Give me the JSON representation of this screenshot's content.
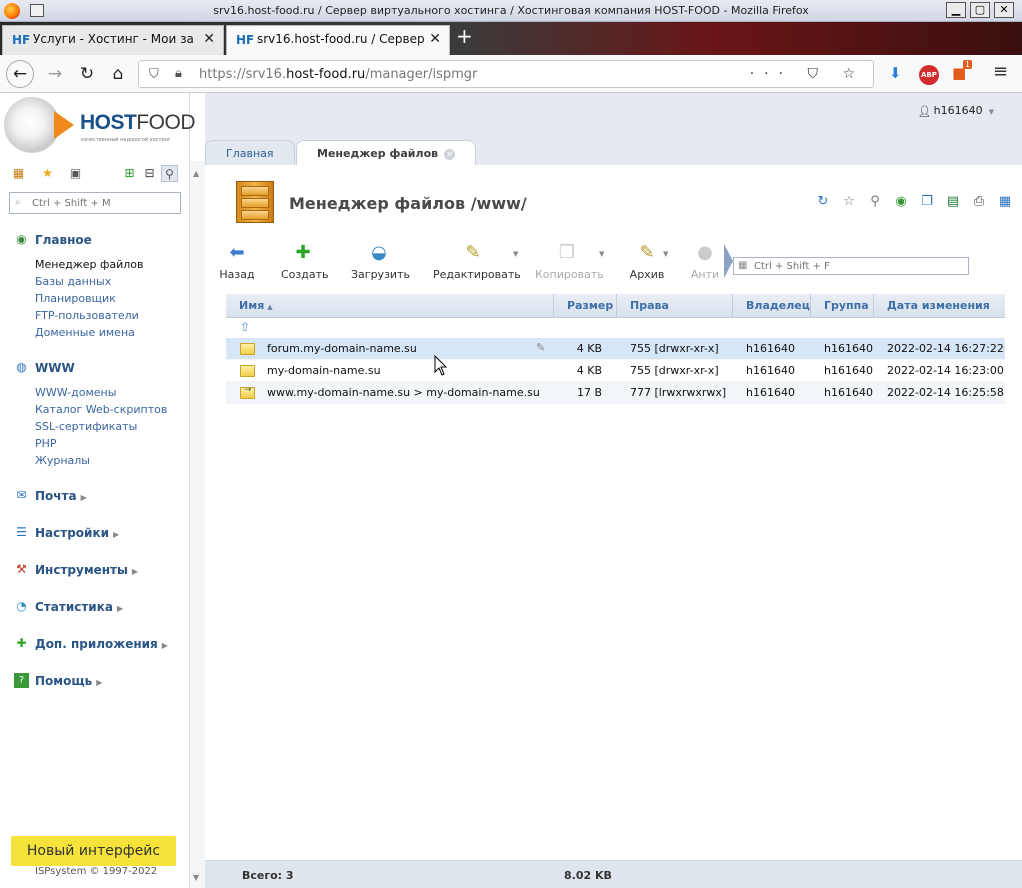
{
  "window": {
    "title": "srv16.host-food.ru / Сервер виртуального хостинга / Хостинговая компания HOST-FOOD - Mozilla Firefox",
    "controls": {
      "minimize": "▁",
      "maximize": "▢",
      "close": "✕"
    }
  },
  "browser": {
    "tabs": [
      {
        "icon": "HF",
        "label": "Услуги - Хостинг - Мои за",
        "active": false
      },
      {
        "icon": "HF",
        "label": "srv16.host-food.ru / Сервер",
        "active": true
      }
    ],
    "new_tab": "+",
    "url_prefix": "https://srv16.",
    "url_domain": "host-food.ru",
    "url_path": "/manager/ispmgr",
    "url_actions": "··· ⛉ ☆",
    "addon_badge": "1",
    "abp_label": "ABP",
    "menu_icon": "≡"
  },
  "logo": {
    "brand_bold": "HOST",
    "brand_rest": "FOOD",
    "tagline": "качественный недорогой хостинг"
  },
  "user": {
    "name": "h161640"
  },
  "sidebar": {
    "search_placeholder": "Ctrl + Shift + M",
    "groups": [
      {
        "label": "Главное",
        "icon": "home-icon",
        "items": [
          "Менеджер файлов",
          "Базы данных",
          "Планировщик",
          "FTP-пользователи",
          "Доменные имена"
        ]
      },
      {
        "label": "WWW",
        "icon": "globe-icon",
        "items": [
          "WWW-домены",
          "Каталог Web-скриптов",
          "SSL-сертификаты",
          "PHP",
          "Журналы"
        ]
      },
      {
        "label": "Почта",
        "icon": "mail-icon",
        "items": []
      },
      {
        "label": "Настройки",
        "icon": "settings-icon",
        "items": []
      },
      {
        "label": "Инструменты",
        "icon": "tools-icon",
        "items": []
      },
      {
        "label": "Статистика",
        "icon": "stats-icon",
        "items": []
      },
      {
        "label": "Доп. приложения",
        "icon": "plus-icon",
        "items": []
      },
      {
        "label": "Помощь",
        "icon": "help-icon",
        "items": []
      }
    ],
    "new_interface": "Новый интерфейс",
    "copyright": "ISPsystem © 1997-2022"
  },
  "tabs": [
    {
      "label": "Главная"
    },
    {
      "label": "Менеджер файлов"
    }
  ],
  "page": {
    "title": "Менеджер файлов /www/"
  },
  "toolbar": {
    "buttons": [
      {
        "label": "Назад",
        "icon": "back-arrow-icon",
        "disabled": false
      },
      {
        "label": "Создать",
        "icon": "create-icon",
        "disabled": false
      },
      {
        "label": "Загрузить",
        "icon": "upload-icon",
        "disabled": false
      },
      {
        "label": "Редактировать",
        "icon": "edit-icon",
        "disabled": false
      },
      {
        "label": "Копировать",
        "icon": "copy-icon",
        "disabled": true
      },
      {
        "label": "Архив",
        "icon": "archive-icon",
        "disabled": false
      },
      {
        "label": "Анти",
        "icon": "antivirus-icon",
        "disabled": true
      }
    ],
    "search_placeholder": "Ctrl + Shift + F"
  },
  "grid": {
    "columns": [
      "Имя",
      "Размер",
      "Права",
      "Владелец",
      "Группа",
      "Дата изменения"
    ],
    "rows": [
      {
        "name": "forum.my-domain-name.su",
        "size": "4 KB",
        "perms": "755 [drwxr-xr-x]",
        "owner": "h161640",
        "group": "h161640",
        "modified": "2022-02-14 16:27:22",
        "type": "folder",
        "selected": true
      },
      {
        "name": "my-domain-name.su",
        "size": "4 KB",
        "perms": "755 [drwxr-xr-x]",
        "owner": "h161640",
        "group": "h161640",
        "modified": "2022-02-14 16:23:00",
        "type": "folder",
        "selected": false
      },
      {
        "name": "www.my-domain-name.su > my-domain-name.su",
        "size": "17 B",
        "perms": "777 [lrwxrwxrwx]",
        "owner": "h161640",
        "group": "h161640",
        "modified": "2022-02-14 16:25:58",
        "type": "link",
        "selected": false
      }
    ]
  },
  "footer": {
    "total": "Всего: 3",
    "size": "8.02 KB"
  }
}
